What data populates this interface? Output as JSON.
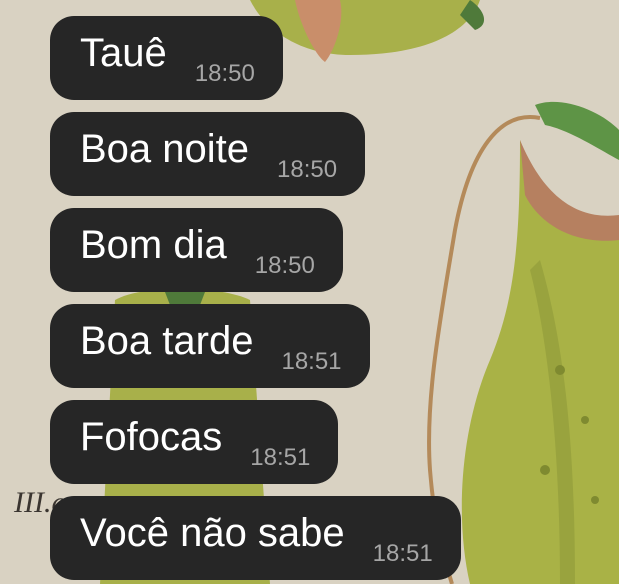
{
  "wallpaper": {
    "background": "#d9d2c2",
    "illustration": "pitcher-plant-botanical",
    "caption_fragment": "III.a"
  },
  "colors": {
    "bubble": "#262626",
    "text": "#ffffff",
    "time": "#a6a6a6"
  },
  "messages": [
    {
      "text": "Tauê",
      "time": "18:50"
    },
    {
      "text": "Boa noite",
      "time": "18:50"
    },
    {
      "text": "Bom dia",
      "time": "18:50"
    },
    {
      "text": "Boa tarde",
      "time": "18:51"
    },
    {
      "text": "Fofocas",
      "time": "18:51"
    },
    {
      "text": "Você não sabe",
      "time": "18:51"
    }
  ]
}
